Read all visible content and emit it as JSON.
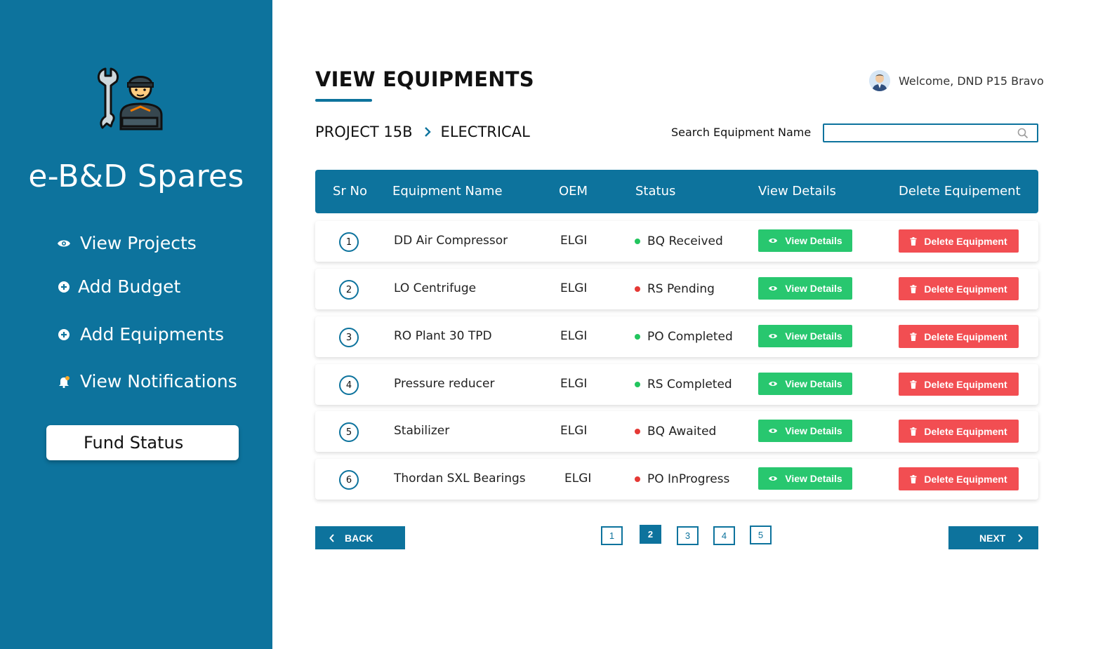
{
  "sidebar": {
    "brand": "e-B&D Spares",
    "nav": [
      {
        "label": "View Projects",
        "icon": "eye-icon"
      },
      {
        "label": "Add Budget",
        "icon": "plus-circle-icon"
      },
      {
        "label": "Add Equipments",
        "icon": "plus-circle-icon"
      },
      {
        "label": "View Notifications",
        "icon": "bell-icon"
      }
    ],
    "fund_status_label": "Fund Status"
  },
  "header": {
    "title": "VIEW EQUIPMENTS",
    "welcome": "Welcome, DND P15 Bravo"
  },
  "breadcrumb": {
    "project": "PROJECT 15B",
    "section": "ELECTRICAL"
  },
  "search": {
    "label": "Search Equipment Name",
    "value": "",
    "placeholder": ""
  },
  "table": {
    "headers": {
      "sr_no": "Sr No",
      "name": "Equipment Name",
      "oem": "OEM",
      "status": "Status",
      "view": "View Details",
      "delete": "Delete Equipement"
    },
    "view_button_label": "View Details",
    "delete_button_label": "Delete Equipment",
    "rows": [
      {
        "sr": "1",
        "name": "DD Air Compressor",
        "oem": "ELGI",
        "status": "BQ Received",
        "status_color": "#22c55e"
      },
      {
        "sr": "2",
        "name": "LO Centrifuge",
        "oem": "ELGI",
        "status": "RS Pending",
        "status_color": "#e53935"
      },
      {
        "sr": "3",
        "name": "RO Plant 30 TPD",
        "oem": "ELGI",
        "status": "PO Completed",
        "status_color": "#22c55e"
      },
      {
        "sr": "4",
        "name": "Pressure reducer",
        "oem": "ELGI",
        "status": "RS Completed",
        "status_color": "#22c55e"
      },
      {
        "sr": "5",
        "name": "Stabilizer",
        "oem": "ELGI",
        "status": "BQ Awaited",
        "status_color": "#e53935"
      },
      {
        "sr": "6",
        "name": "Thordan SXL Bearings",
        "oem": "ELGI",
        "status": "PO InProgress",
        "status_color": "#e53935"
      }
    ]
  },
  "pagination": {
    "back_label": "BACK",
    "next_label": "NEXT",
    "pages": [
      "1",
      "2",
      "3",
      "4",
      "5"
    ],
    "current": "2"
  },
  "colors": {
    "primary": "#0d739d",
    "view_button": "#28c76f",
    "delete_button": "#f24e52"
  }
}
